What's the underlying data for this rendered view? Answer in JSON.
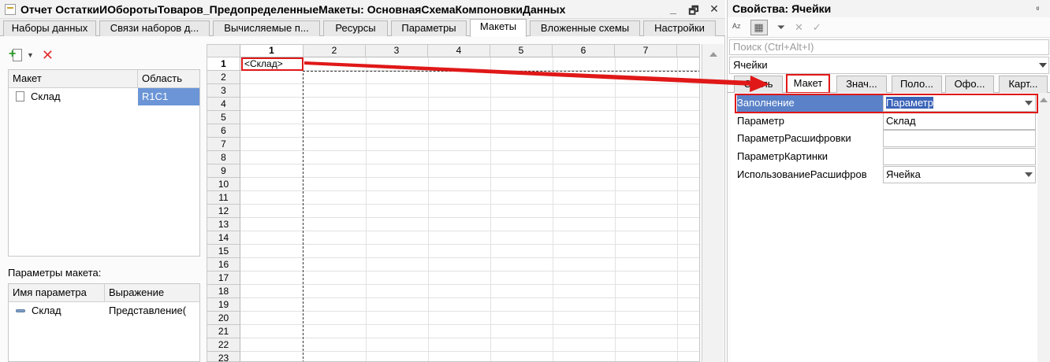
{
  "window": {
    "title": "Отчет ОстаткиИОборотыТоваров_ПредопределенныеМакеты: ОсновнаяСхемаКомпоновкиДанных",
    "controls": [
      "_",
      "🗗",
      "✕"
    ]
  },
  "tabs": [
    {
      "label": "Наборы данных"
    },
    {
      "label": "Связи наборов д..."
    },
    {
      "label": "Вычисляемые п..."
    },
    {
      "label": "Ресурсы"
    },
    {
      "label": "Параметры"
    },
    {
      "label": "Макеты"
    },
    {
      "label": "Вложенные схемы"
    },
    {
      "label": "Настройки"
    }
  ],
  "layouts_table": {
    "headers": [
      "Макет",
      "Область"
    ],
    "rows": [
      {
        "name": "Склад",
        "area": "R1C1"
      }
    ]
  },
  "params": {
    "label": "Параметры макета:",
    "headers": [
      "Имя параметра",
      "Выражение"
    ],
    "rows": [
      {
        "name": "Склад",
        "expr": "Представление("
      }
    ]
  },
  "sheet": {
    "columns": [
      "1",
      "2",
      "3",
      "4",
      "5",
      "6",
      "7"
    ],
    "rows": [
      "1",
      "2",
      "3",
      "4",
      "5",
      "6",
      "7",
      "8",
      "9",
      "10",
      "11",
      "12",
      "13",
      "14",
      "15",
      "16",
      "17",
      "18",
      "19",
      "20",
      "21",
      "22",
      "23"
    ],
    "cell_r1c1": "<Склад>"
  },
  "props": {
    "title": "Свойства: Ячейки",
    "pin": "ᵍ",
    "search_placeholder": "Поиск (Ctrl+Alt+I)",
    "object": "Ячейки",
    "toolbar": {
      "sort": "ᴬᶻ",
      "cat": "▦",
      "filter": "⏷",
      "del": "✕",
      "ok": "✓"
    },
    "tabs": [
      {
        "label": "Стиль"
      },
      {
        "label": "Макет"
      },
      {
        "label": "Знач..."
      },
      {
        "label": "Поло..."
      },
      {
        "label": "Офо..."
      },
      {
        "label": "Карт..."
      }
    ],
    "rows": [
      {
        "name": "Заполнение",
        "value": "Параметр",
        "dropdown": true
      },
      {
        "name": "Параметр",
        "value": "Склад",
        "dropdown": false
      },
      {
        "name": "ПараметрРасшифровки",
        "value": "",
        "dropdown": false
      },
      {
        "name": "ПараметрКартинки",
        "value": "",
        "dropdown": false
      },
      {
        "name": "ИспользованиеРасшифров",
        "value": "Ячейка",
        "dropdown": true
      }
    ]
  },
  "colors": {
    "highlight": "#e01818",
    "selection": "#5b82c8"
  }
}
